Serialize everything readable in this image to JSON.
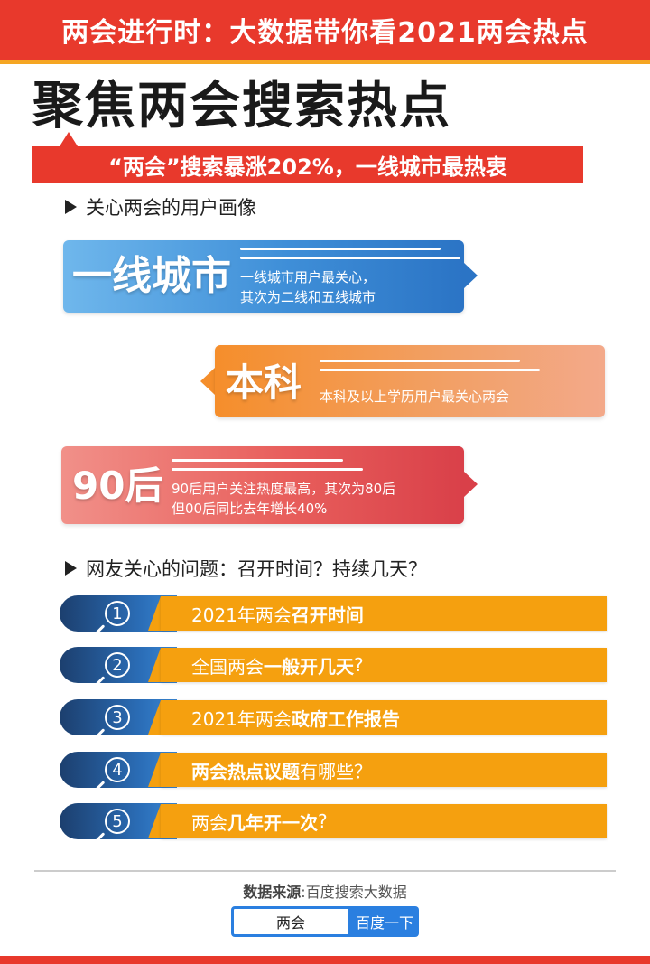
{
  "header": {
    "banner_title": "两会进行时：大数据带你看2021两会热点",
    "main_title": "聚焦两会搜索热点",
    "ribbon": "“两会”搜索暴涨202%，一线城市最热衷"
  },
  "colors": {
    "accent_red": "#e8392c",
    "accent_orange": "#f5a00f",
    "accent_blue": "#2a7fe0"
  },
  "section_users": {
    "heading": "关心两会的用户画像",
    "cards": [
      {
        "label": "一线城市",
        "desc_line1": "一线城市用户最关心，",
        "desc_line2": "其次为二线和五线城市"
      },
      {
        "label": "本科",
        "desc_line1": "本科及以上学历用户最关心两会"
      },
      {
        "label": "90后",
        "desc_line1": "90后用户关注热度最高，其次为80后",
        "desc_line2": "但00后同比去年增长40%"
      }
    ]
  },
  "section_questions": {
    "heading": "网友关心的问题：召开时间？持续几天？",
    "items": [
      {
        "num": "1",
        "pre": "2021年两会",
        "bold": "召开时间",
        "post": ""
      },
      {
        "num": "2",
        "pre": "全国两会",
        "bold": "一般开几天",
        "post": "?"
      },
      {
        "num": "3",
        "pre": "2021年两会",
        "bold": "政府工作报告",
        "post": ""
      },
      {
        "num": "4",
        "pre": "",
        "bold": "两会热点议题",
        "post": "有哪些？"
      },
      {
        "num": "5",
        "pre": "两会",
        "bold": "几年开一次",
        "post": "?"
      }
    ]
  },
  "footer": {
    "source_label": "数据来源",
    "source_sep": ":",
    "source_value": "百度搜索大数据",
    "search_value": "两会",
    "search_button": "百度一下"
  }
}
